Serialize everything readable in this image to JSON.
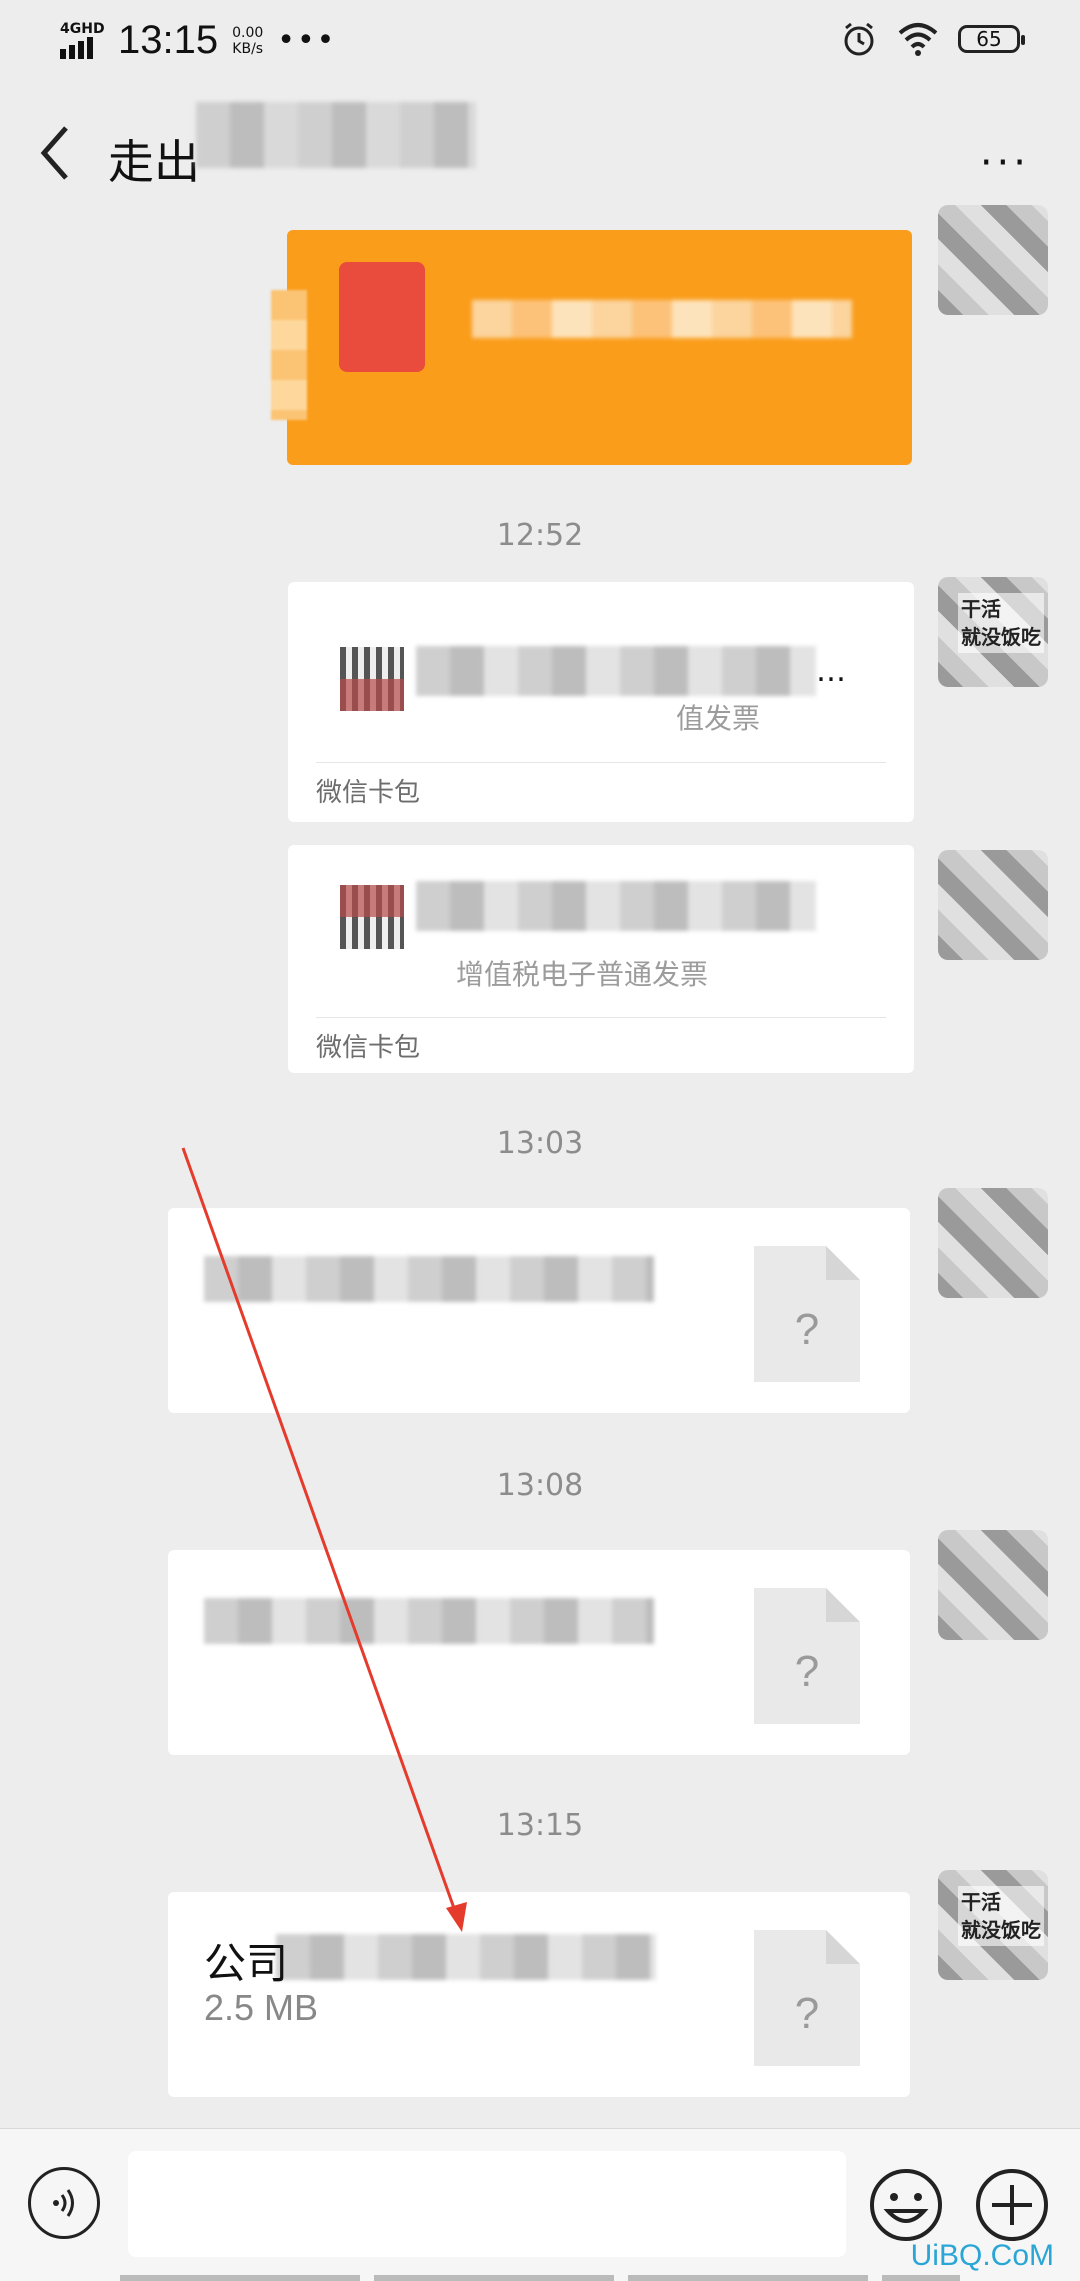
{
  "status_bar": {
    "network": "4GHD",
    "time": "13:15",
    "speed_value": "0.00",
    "speed_unit": "KB/s",
    "more": "•••",
    "battery": "65",
    "icons": [
      "signal-icon",
      "alarm-icon",
      "wifi-icon",
      "battery-icon"
    ]
  },
  "header": {
    "title": "走出",
    "more": "···"
  },
  "messages": {
    "timestamps": [
      "12:52",
      "13:03",
      "13:08",
      "13:15"
    ],
    "invoice_cards": [
      {
        "title_tail": "…",
        "subtitle": "值发票",
        "source": "微信卡包"
      },
      {
        "subtitle": "增值税电子普通发票",
        "source": "微信卡包"
      }
    ],
    "file_cards": [
      {
        "name": "",
        "size": ""
      },
      {
        "name": "",
        "size": ""
      },
      {
        "name": "公司",
        "size": "2.5 MB"
      }
    ],
    "avatar_text": "干活\n就没饭吃"
  },
  "input_bar": {
    "placeholder": "",
    "icons": [
      "voice-icon",
      "emoji-icon",
      "plus-icon"
    ]
  },
  "watermark": "UiBQ.CoM",
  "colors": {
    "background": "#ededed",
    "red_packet": "#fa9d1b",
    "arrow": "#e53b2c"
  }
}
